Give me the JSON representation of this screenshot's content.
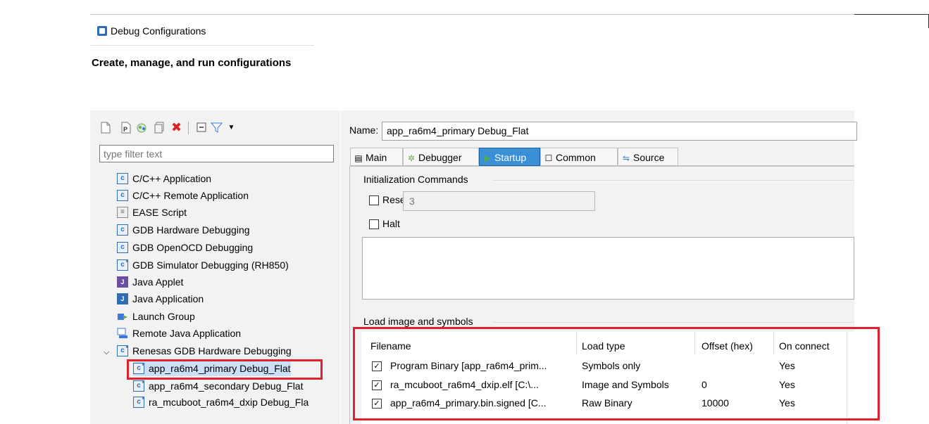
{
  "window": {
    "title": "Debug Configurations",
    "subtitle": "Create, manage, and run configurations"
  },
  "toolbar": {
    "icons": [
      "new-configuration-icon",
      "new-prototype-icon",
      "export-icon",
      "duplicate-icon",
      "delete-icon",
      "collapse-all-icon",
      "filter-icon",
      "dropdown-icon"
    ]
  },
  "filter": {
    "placeholder": "type filter text"
  },
  "tree": {
    "items": [
      {
        "label": "C/C++ Application",
        "icon": "c"
      },
      {
        "label": "C/C++ Remote Application",
        "icon": "c"
      },
      {
        "label": "EASE Script",
        "icon": "ease"
      },
      {
        "label": "GDB Hardware Debugging",
        "icon": "c"
      },
      {
        "label": "GDB OpenOCD Debugging",
        "icon": "c"
      },
      {
        "label": "GDB Simulator Debugging (RH850)",
        "icon": "c-star"
      },
      {
        "label": "Java Applet",
        "icon": "java-applet"
      },
      {
        "label": "Java Application",
        "icon": "java"
      },
      {
        "label": "Launch Group",
        "icon": "launch-group"
      },
      {
        "label": "Remote Java Application",
        "icon": "remote-java"
      },
      {
        "label": "Renesas GDB Hardware Debugging",
        "icon": "c-star"
      }
    ],
    "children": [
      {
        "label": "app_ra6m4_primary Debug_Flat",
        "selected": true
      },
      {
        "label": "app_ra6m4_secondary Debug_Flat"
      },
      {
        "label": "ra_mcuboot_ra6m4_dxip Debug_Fla"
      }
    ]
  },
  "config": {
    "name_label": "Name:",
    "name_value": "app_ra6m4_primary Debug_Flat",
    "tabs": [
      {
        "label": "Main"
      },
      {
        "label": "Debugger"
      },
      {
        "label": "Startup",
        "active": true
      },
      {
        "label": "Common"
      },
      {
        "label": "Source"
      }
    ],
    "init": {
      "group_label": "Initialization Commands",
      "reset_label": "Reset and Delay (seconds):",
      "reset_checked": false,
      "delay_value": "3",
      "halt_label": "Halt",
      "halt_checked": false
    },
    "load": {
      "group_label": "Load image and symbols",
      "columns": [
        "Filename",
        "Load type",
        "Offset (hex)",
        "On connect"
      ],
      "rows": [
        {
          "filename": "Program Binary [app_ra6m4_prim...",
          "load_type": "Symbols only",
          "offset": "",
          "on_connect": "Yes",
          "checked": true
        },
        {
          "filename": "ra_mcuboot_ra6m4_dxip.elf [C:\\...",
          "load_type": "Image and Symbols",
          "offset": "0",
          "on_connect": "Yes",
          "checked": true
        },
        {
          "filename": "app_ra6m4_primary.bin.signed [C...",
          "load_type": "Raw Binary",
          "offset": "10000",
          "on_connect": "Yes",
          "checked": true
        }
      ]
    }
  },
  "colors": {
    "highlight": "#e0202a",
    "active_tab": "#3b8fd5",
    "panel_bg": "#f2f2f2"
  }
}
